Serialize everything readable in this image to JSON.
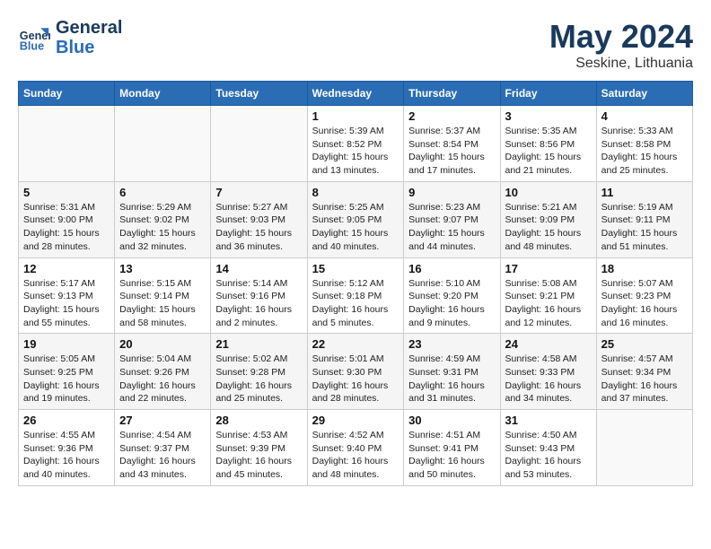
{
  "header": {
    "logo_general": "General",
    "logo_blue": "Blue",
    "month": "May 2024",
    "location": "Seskine, Lithuania"
  },
  "days_of_week": [
    "Sunday",
    "Monday",
    "Tuesday",
    "Wednesday",
    "Thursday",
    "Friday",
    "Saturday"
  ],
  "weeks": [
    [
      {
        "day": "",
        "info": ""
      },
      {
        "day": "",
        "info": ""
      },
      {
        "day": "",
        "info": ""
      },
      {
        "day": "1",
        "info": "Sunrise: 5:39 AM\nSunset: 8:52 PM\nDaylight: 15 hours\nand 13 minutes."
      },
      {
        "day": "2",
        "info": "Sunrise: 5:37 AM\nSunset: 8:54 PM\nDaylight: 15 hours\nand 17 minutes."
      },
      {
        "day": "3",
        "info": "Sunrise: 5:35 AM\nSunset: 8:56 PM\nDaylight: 15 hours\nand 21 minutes."
      },
      {
        "day": "4",
        "info": "Sunrise: 5:33 AM\nSunset: 8:58 PM\nDaylight: 15 hours\nand 25 minutes."
      }
    ],
    [
      {
        "day": "5",
        "info": "Sunrise: 5:31 AM\nSunset: 9:00 PM\nDaylight: 15 hours\nand 28 minutes."
      },
      {
        "day": "6",
        "info": "Sunrise: 5:29 AM\nSunset: 9:02 PM\nDaylight: 15 hours\nand 32 minutes."
      },
      {
        "day": "7",
        "info": "Sunrise: 5:27 AM\nSunset: 9:03 PM\nDaylight: 15 hours\nand 36 minutes."
      },
      {
        "day": "8",
        "info": "Sunrise: 5:25 AM\nSunset: 9:05 PM\nDaylight: 15 hours\nand 40 minutes."
      },
      {
        "day": "9",
        "info": "Sunrise: 5:23 AM\nSunset: 9:07 PM\nDaylight: 15 hours\nand 44 minutes."
      },
      {
        "day": "10",
        "info": "Sunrise: 5:21 AM\nSunset: 9:09 PM\nDaylight: 15 hours\nand 48 minutes."
      },
      {
        "day": "11",
        "info": "Sunrise: 5:19 AM\nSunset: 9:11 PM\nDaylight: 15 hours\nand 51 minutes."
      }
    ],
    [
      {
        "day": "12",
        "info": "Sunrise: 5:17 AM\nSunset: 9:13 PM\nDaylight: 15 hours\nand 55 minutes."
      },
      {
        "day": "13",
        "info": "Sunrise: 5:15 AM\nSunset: 9:14 PM\nDaylight: 15 hours\nand 58 minutes."
      },
      {
        "day": "14",
        "info": "Sunrise: 5:14 AM\nSunset: 9:16 PM\nDaylight: 16 hours\nand 2 minutes."
      },
      {
        "day": "15",
        "info": "Sunrise: 5:12 AM\nSunset: 9:18 PM\nDaylight: 16 hours\nand 5 minutes."
      },
      {
        "day": "16",
        "info": "Sunrise: 5:10 AM\nSunset: 9:20 PM\nDaylight: 16 hours\nand 9 minutes."
      },
      {
        "day": "17",
        "info": "Sunrise: 5:08 AM\nSunset: 9:21 PM\nDaylight: 16 hours\nand 12 minutes."
      },
      {
        "day": "18",
        "info": "Sunrise: 5:07 AM\nSunset: 9:23 PM\nDaylight: 16 hours\nand 16 minutes."
      }
    ],
    [
      {
        "day": "19",
        "info": "Sunrise: 5:05 AM\nSunset: 9:25 PM\nDaylight: 16 hours\nand 19 minutes."
      },
      {
        "day": "20",
        "info": "Sunrise: 5:04 AM\nSunset: 9:26 PM\nDaylight: 16 hours\nand 22 minutes."
      },
      {
        "day": "21",
        "info": "Sunrise: 5:02 AM\nSunset: 9:28 PM\nDaylight: 16 hours\nand 25 minutes."
      },
      {
        "day": "22",
        "info": "Sunrise: 5:01 AM\nSunset: 9:30 PM\nDaylight: 16 hours\nand 28 minutes."
      },
      {
        "day": "23",
        "info": "Sunrise: 4:59 AM\nSunset: 9:31 PM\nDaylight: 16 hours\nand 31 minutes."
      },
      {
        "day": "24",
        "info": "Sunrise: 4:58 AM\nSunset: 9:33 PM\nDaylight: 16 hours\nand 34 minutes."
      },
      {
        "day": "25",
        "info": "Sunrise: 4:57 AM\nSunset: 9:34 PM\nDaylight: 16 hours\nand 37 minutes."
      }
    ],
    [
      {
        "day": "26",
        "info": "Sunrise: 4:55 AM\nSunset: 9:36 PM\nDaylight: 16 hours\nand 40 minutes."
      },
      {
        "day": "27",
        "info": "Sunrise: 4:54 AM\nSunset: 9:37 PM\nDaylight: 16 hours\nand 43 minutes."
      },
      {
        "day": "28",
        "info": "Sunrise: 4:53 AM\nSunset: 9:39 PM\nDaylight: 16 hours\nand 45 minutes."
      },
      {
        "day": "29",
        "info": "Sunrise: 4:52 AM\nSunset: 9:40 PM\nDaylight: 16 hours\nand 48 minutes."
      },
      {
        "day": "30",
        "info": "Sunrise: 4:51 AM\nSunset: 9:41 PM\nDaylight: 16 hours\nand 50 minutes."
      },
      {
        "day": "31",
        "info": "Sunrise: 4:50 AM\nSunset: 9:43 PM\nDaylight: 16 hours\nand 53 minutes."
      },
      {
        "day": "",
        "info": ""
      }
    ]
  ]
}
